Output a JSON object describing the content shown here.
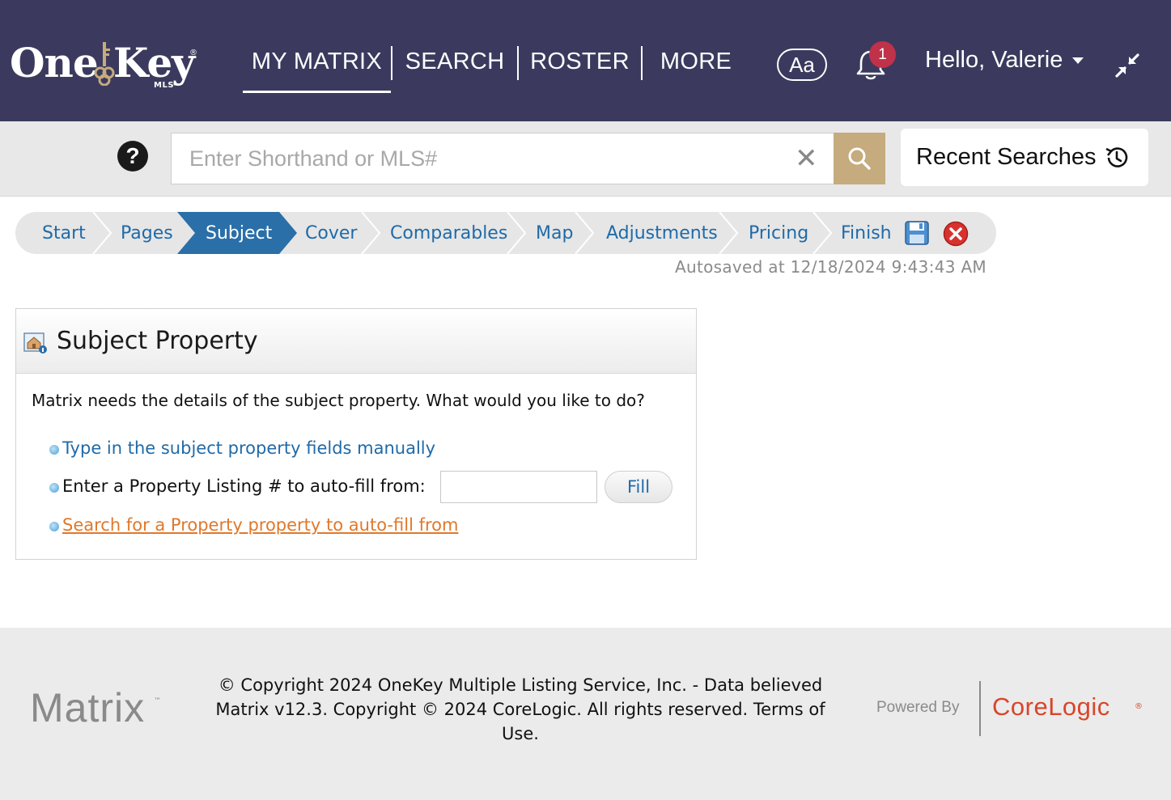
{
  "brand": {
    "logo_one": "One",
    "logo_key": "Key",
    "logo_mls": "MLS",
    "logo_reg": "®"
  },
  "nav": {
    "items": [
      "MY MATRIX",
      "SEARCH",
      "ROSTER",
      "MORE"
    ],
    "active": "MY MATRIX"
  },
  "header": {
    "font_button": "Aa",
    "notification_count": "1",
    "greeting": "Hello, Valerie"
  },
  "search": {
    "placeholder": "Enter Shorthand or MLS#",
    "value": "",
    "clear_label": "✕",
    "recent_label": "Recent Searches"
  },
  "help": {
    "label": "?"
  },
  "wizard": {
    "steps": [
      "Start",
      "Pages",
      "Subject",
      "Cover",
      "Comparables",
      "Map",
      "Adjustments",
      "Pricing",
      "Finish"
    ],
    "active_step": "Subject",
    "autosaved": "Autosaved at 12/18/2024 9:43:43 AM"
  },
  "panel": {
    "title": "Subject Property",
    "intro": "Matrix needs the details of the subject property. What would you like to do?",
    "option_manual": "Type in the subject property fields manually",
    "option_listing": "Enter a Property Listing # to auto-fill from:",
    "listing_value": "",
    "fill_label": "Fill",
    "option_search": "Search for a Property property to auto-fill from"
  },
  "footer": {
    "matrix_logo": "Matrix",
    "matrix_tm": "™",
    "copyright_line1": "© Copyright 2024 OneKey Multiple Listing Service, Inc. - Data believed",
    "copyright_line2": "Matrix v12.3. Copyright © 2024 CoreLogic. All rights reserved. Terms of",
    "copyright_line3": "Use.",
    "powered_by": "Powered By",
    "corelogic": "CoreLogic",
    "corelogic_mark": "®"
  },
  "colors": {
    "header_bg": "#3b3a5e",
    "search_button": "#c5ab7d",
    "wizard_active": "#2a6fa8",
    "link_blue": "#1f6aa8",
    "link_orange": "#e0782a",
    "badge": "#c0314a",
    "corelogic": "#d9452b"
  },
  "icons": [
    "key-icon",
    "bell-icon",
    "collapse-icon",
    "help-icon",
    "search-icon",
    "history-icon",
    "save-icon",
    "close-circle-icon",
    "property-icon",
    "bullet-icon"
  ]
}
